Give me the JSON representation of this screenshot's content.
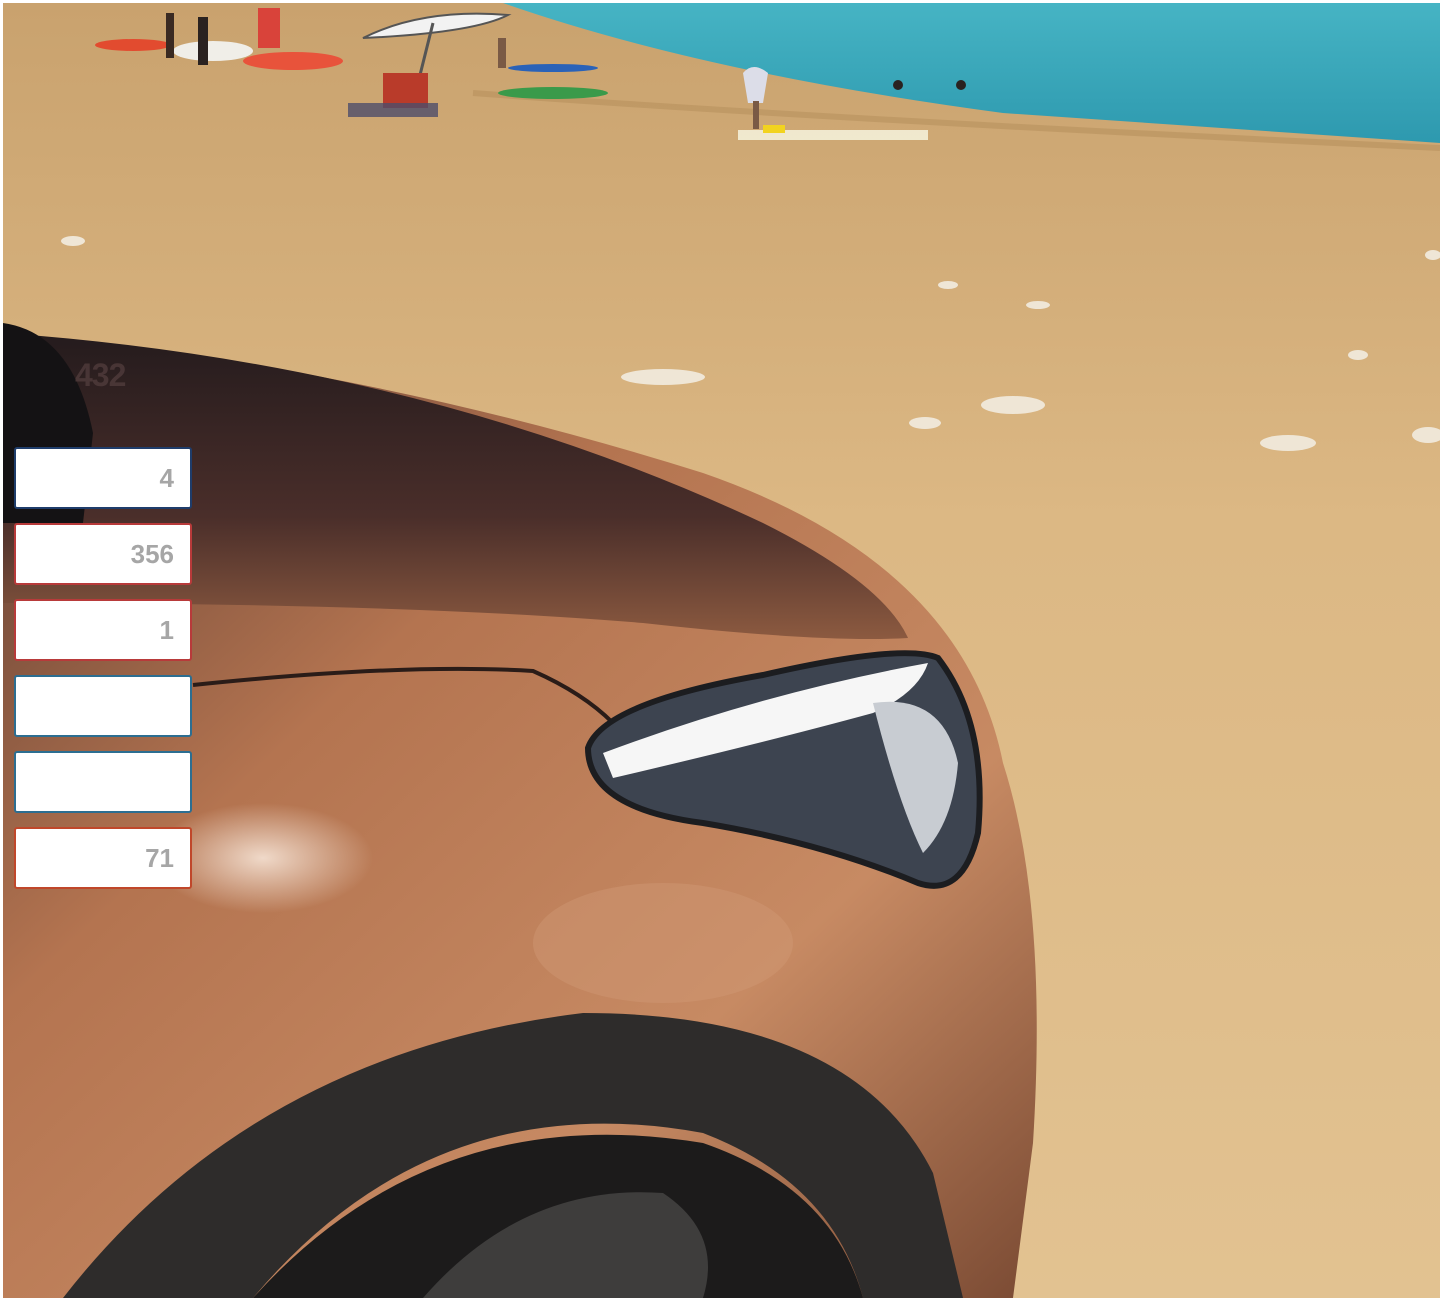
{
  "overlay": {
    "top_number": "432"
  },
  "fields": [
    {
      "value": "4",
      "border_color": "#1f3d6b"
    },
    {
      "value": "356",
      "border_color": "#b83a3a"
    },
    {
      "value": "1",
      "border_color": "#b83a3a"
    },
    {
      "value": "",
      "border_color": "#2c6e91"
    },
    {
      "value": "",
      "border_color": "#2c6e91"
    },
    {
      "value": "71",
      "border_color": "#c0472a"
    }
  ],
  "colors": {
    "sea": "#3aa7b9",
    "sand": "#d9b27a",
    "car_paint": "#a8623d",
    "fender_trim": "#2d2b2a"
  }
}
